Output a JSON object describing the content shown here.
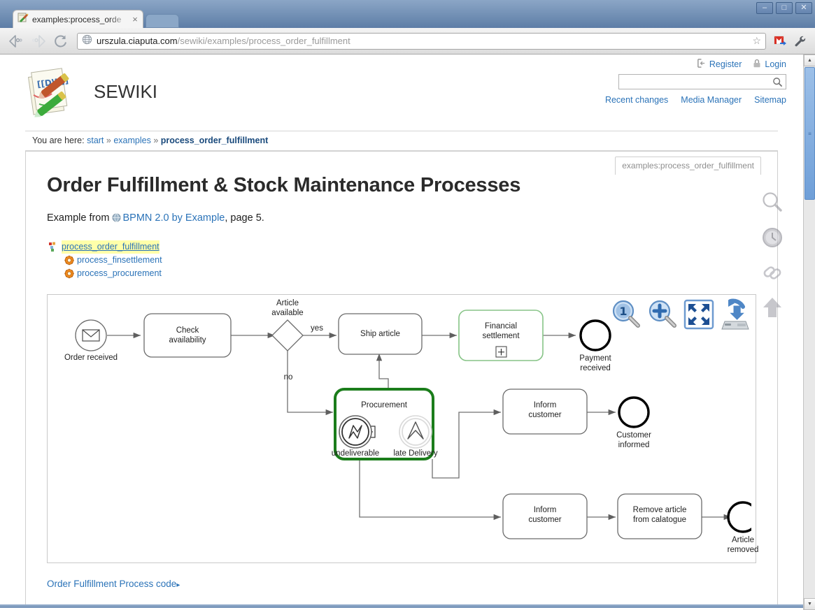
{
  "browser": {
    "tab_title": "examples:process_orde",
    "tab_close": "×",
    "url_host": "urszula.ciaputa.com",
    "url_path": "/sewiki/examples/process_order_fulfillment",
    "window_buttons": {
      "minimize": "–",
      "maximize": "□",
      "close": "✕"
    },
    "icons": {
      "back": "back-arrow-icon",
      "forward": "forward-arrow-icon",
      "reload": "reload-icon",
      "site": "globe-icon",
      "bookmark": "star-icon",
      "gmail": "gmail-icon",
      "menu": "wrench-icon"
    }
  },
  "wiki": {
    "site_title": "SEWIKI",
    "user_tools": [
      {
        "label": "Register",
        "icon": "register-icon"
      },
      {
        "label": "Login",
        "icon": "lock-icon"
      }
    ],
    "search": {
      "placeholder": "",
      "value": "",
      "icon": "search-icon"
    },
    "site_tools": [
      {
        "label": "Recent changes"
      },
      {
        "label": "Media Manager"
      },
      {
        "label": "Sitemap"
      }
    ],
    "breadcrumb": {
      "prefix": "You are here:",
      "items": [
        "start",
        "examples"
      ],
      "separator": "»",
      "current": "process_order_fulfillment"
    },
    "page_tab": "examples:process_order_fulfillment",
    "page_title": "Order Fulfillment & Stock Maintenance Processes",
    "lead": {
      "before": "Example from",
      "link": "BPMN 2.0 by Example",
      "after": ", page 5."
    },
    "tree": [
      {
        "label": "process_order_fulfillment",
        "icon": "page-icon",
        "current": true
      },
      {
        "label": "process_finsettlement",
        "icon": "gear-icon",
        "current": false
      },
      {
        "label": "process_procurement",
        "icon": "gear-icon",
        "current": false
      }
    ],
    "code_link": "Order Fulfillment Process code",
    "code_link_arrow": "▸",
    "rail": [
      {
        "name": "search-icon"
      },
      {
        "name": "clock-icon"
      },
      {
        "name": "backlinks-icon"
      },
      {
        "name": "back-to-top-icon"
      }
    ]
  },
  "diagram": {
    "tools": [
      {
        "name": "zoom-100-icon",
        "label": "1"
      },
      {
        "name": "zoom-in-icon",
        "label": "+"
      },
      {
        "name": "fit-to-screen-icon",
        "label": ""
      },
      {
        "name": "save-icon",
        "label": ""
      }
    ],
    "accent_green": "#1b7d1b",
    "accent_light_green": "#87c487",
    "nodes": {
      "start_order": "Order received",
      "check_availability": "Check\navailability",
      "gateway_article": "Article\navailable",
      "ship_article": "Ship article",
      "financial_settlement": "Financial\nsettlement",
      "end_payment": "Payment\nreceived",
      "procurement": "Procurement",
      "boundary_undeliverable": "undeliverable",
      "boundary_late_delivery": "late Delivery",
      "inform_customer_mid": "Inform\ncustomer",
      "end_customer_informed": "Customer\ninformed",
      "inform_customer_bottom": "Inform\ncustomer",
      "remove_article": "Remove article\nfrom calatogue",
      "end_article_removed": "Article\nremoved"
    },
    "flow_labels": {
      "yes": "yes",
      "no": "no"
    },
    "markers": {
      "subprocess_expand": "+"
    }
  }
}
